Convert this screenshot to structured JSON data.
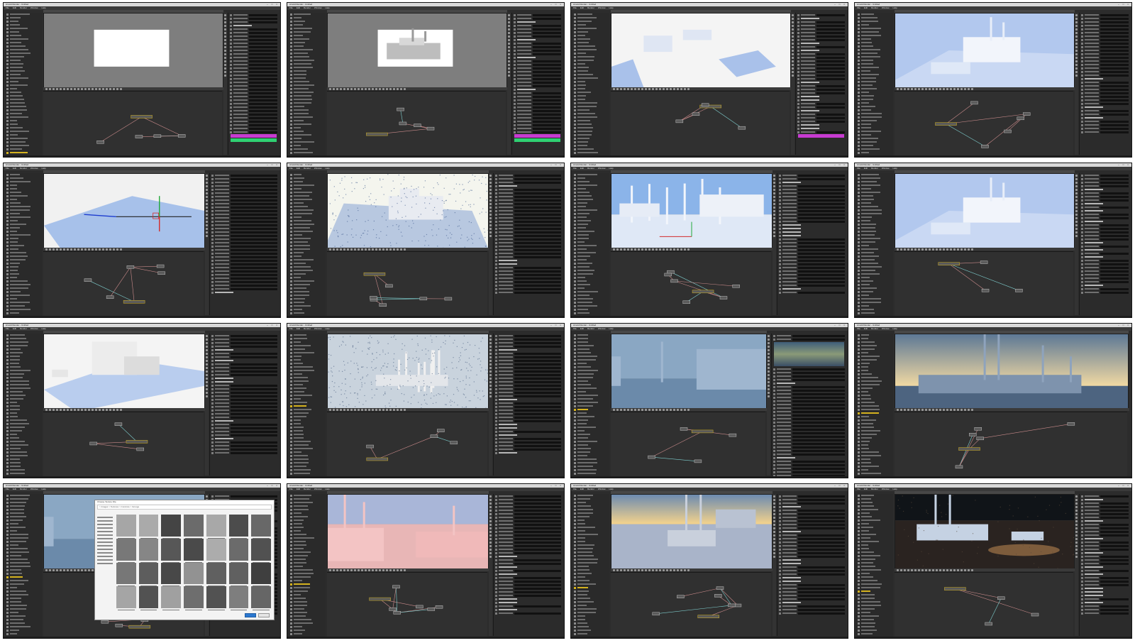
{
  "thumbnails": [
    {
      "title": "Arnold Render - Untitled",
      "scene": "blank",
      "panel": "right",
      "swatches": [
        "#c73bd1",
        "#2fd072"
      ]
    },
    {
      "title": "Arnold Render - Untitled",
      "scene": "building-gray",
      "panel": "right",
      "swatches": [
        "#c73bd1",
        "#2fd072"
      ]
    },
    {
      "title": "Arnold Render - Untitled",
      "scene": "white-blocks",
      "panel": "right",
      "swatches": [
        "#c73bd1"
      ]
    },
    {
      "title": "Arnold Render - Untitled",
      "scene": "blue-building",
      "panel": "right",
      "swatches": []
    },
    {
      "title": "Arnold Render - Untitled",
      "scene": "plane-gizmo",
      "panel": "mid",
      "swatches": []
    },
    {
      "title": "Arnold Render - Untitled",
      "scene": "noisy-building",
      "panel": "mid",
      "swatches": []
    },
    {
      "title": "Arnold Render - Untitled",
      "scene": "spires-blue",
      "panel": "mid",
      "swatches": []
    },
    {
      "title": "Arnold Render - Untitled",
      "scene": "blue-building-2",
      "panel": "right",
      "swatches": []
    },
    {
      "title": "Arnold Render - Untitled",
      "scene": "white-factory",
      "panel": "mid",
      "swatches": []
    },
    {
      "title": "Arnold Render - Untitled",
      "scene": "noisy-city",
      "panel": "mid",
      "swatches": []
    },
    {
      "title": "Arnold Render - Untitled",
      "scene": "dusk-blue",
      "panel": "map",
      "swatches": [
        "#e0792e",
        "#3b6fc7"
      ]
    },
    {
      "title": "Arnold Render - Untitled",
      "scene": "dusk-towers",
      "panel": "none",
      "swatches": []
    },
    {
      "title": "Arnold Render - Untitled",
      "scene": "file-dialog",
      "panel": "mid",
      "swatches": []
    },
    {
      "title": "Arnold Render - Untitled",
      "scene": "pink-city",
      "panel": "mid",
      "swatches": []
    },
    {
      "title": "Arnold Render - Untitled",
      "scene": "sunset-plaza",
      "panel": "mid",
      "swatches": []
    },
    {
      "title": "Arnold Render - Untitled",
      "scene": "night-water",
      "panel": "right",
      "swatches": []
    }
  ],
  "menu": [
    "File",
    "Edit",
    "Render",
    "Window",
    "Help"
  ],
  "dialog": {
    "title": "Choose Texture File",
    "address": "> Images > Textures > Concrete > Grunge"
  },
  "colors": {
    "selection": "#d4b21f",
    "node_link": "#c98a8a",
    "node_link_alt": "#7fd0d0"
  }
}
